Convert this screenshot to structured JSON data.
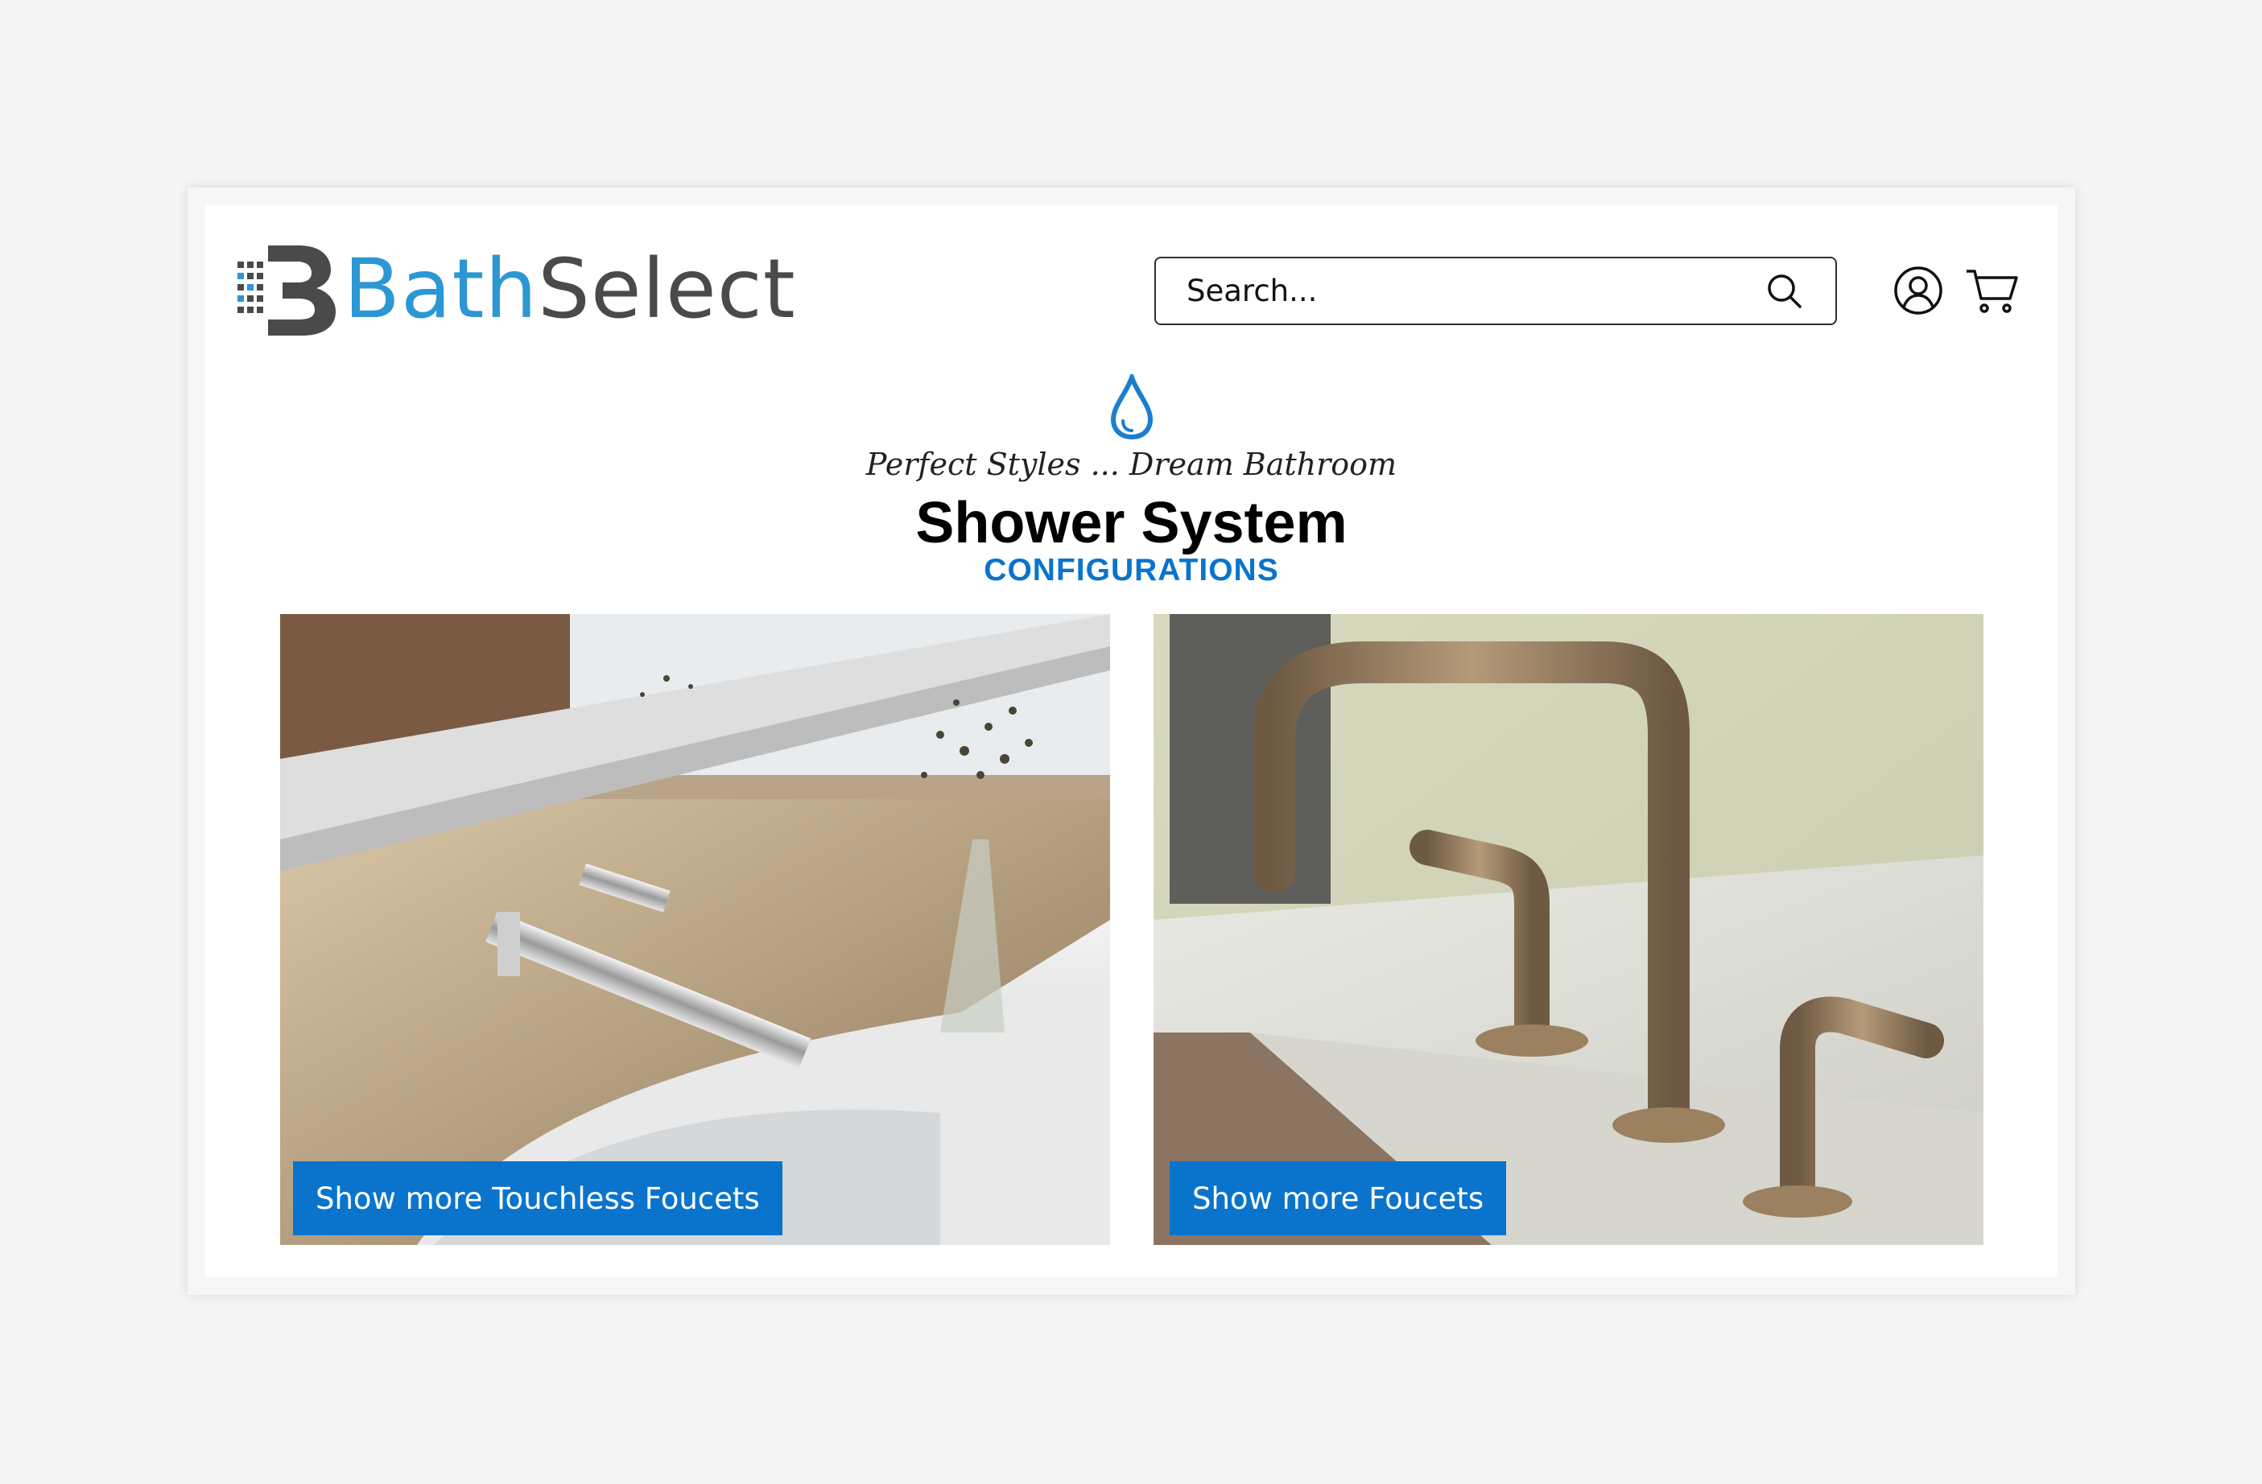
{
  "header": {
    "logo": {
      "part1": "Bath",
      "part2": "Select"
    },
    "search": {
      "placeholder": "Search..."
    },
    "icons": {
      "search": "search-icon",
      "account": "user-icon",
      "cart": "cart-icon"
    }
  },
  "hero": {
    "icon": "water-drop-icon",
    "tagline": "Perfect Styles ... Dream Bathroom",
    "title": "Shower System",
    "subtitle": "CONFIGURATIONS"
  },
  "tiles": [
    {
      "image": "touchless-faucet-photo",
      "button_label": "Show more Touchless Foucets"
    },
    {
      "image": "bronze-faucet-photo",
      "button_label": "Show more Foucets"
    }
  ],
  "colors": {
    "accent": "#0a74cd",
    "logo_blue": "#2d97d3",
    "logo_gray": "#4a4a4a"
  }
}
